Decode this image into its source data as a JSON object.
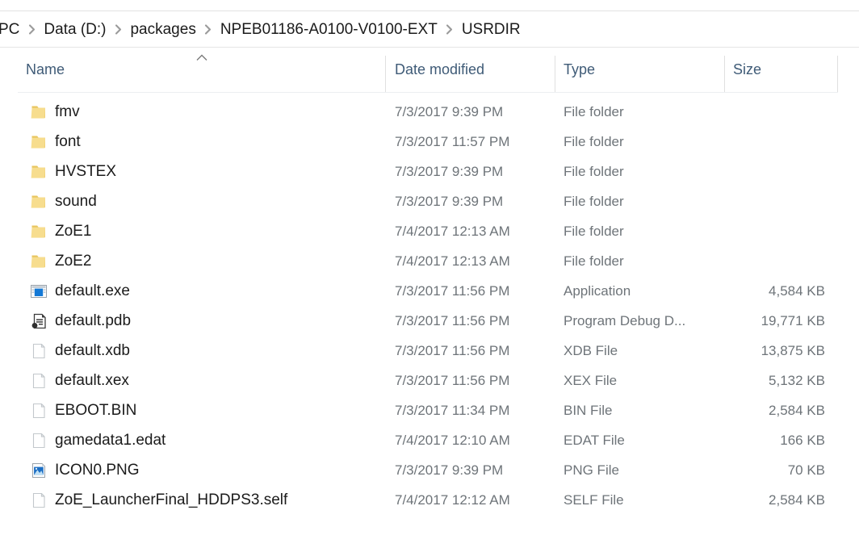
{
  "breadcrumb": {
    "name": "address-breadcrumb",
    "separator_icon": "chevron-right-icon",
    "items": [
      {
        "label": "PC"
      },
      {
        "label": "Data (D:)"
      },
      {
        "label": "packages"
      },
      {
        "label": "NPEB01186-A0100-V0100-EXT"
      },
      {
        "label": "USRDIR"
      }
    ]
  },
  "columns": {
    "name": "Name",
    "date_modified": "Date modified",
    "type": "Type",
    "size": "Size",
    "sort_icon": "sort-ascending-caret-icon",
    "sorted_by": "Name"
  },
  "files": [
    {
      "name": "fmv",
      "date_modified": "7/3/2017 9:39 PM",
      "type": "File folder",
      "size": "",
      "icon": "folder-icon"
    },
    {
      "name": "font",
      "date_modified": "7/3/2017 11:57 PM",
      "type": "File folder",
      "size": "",
      "icon": "folder-icon"
    },
    {
      "name": "HVSTEX",
      "date_modified": "7/3/2017 9:39 PM",
      "type": "File folder",
      "size": "",
      "icon": "folder-icon"
    },
    {
      "name": "sound",
      "date_modified": "7/3/2017 9:39 PM",
      "type": "File folder",
      "size": "",
      "icon": "folder-icon"
    },
    {
      "name": "ZoE1",
      "date_modified": "7/4/2017 12:13 AM",
      "type": "File folder",
      "size": "",
      "icon": "folder-icon"
    },
    {
      "name": "ZoE2",
      "date_modified": "7/4/2017 12:13 AM",
      "type": "File folder",
      "size": "",
      "icon": "folder-icon"
    },
    {
      "name": "default.exe",
      "date_modified": "7/3/2017 11:56 PM",
      "type": "Application",
      "size": "4,584 KB",
      "icon": "application-icon"
    },
    {
      "name": "default.pdb",
      "date_modified": "7/3/2017 11:56 PM",
      "type": "Program Debug D...",
      "size": "19,771 KB",
      "icon": "program-debug-database-icon"
    },
    {
      "name": "default.xdb",
      "date_modified": "7/3/2017 11:56 PM",
      "type": "XDB File",
      "size": "13,875 KB",
      "icon": "blank-document-icon"
    },
    {
      "name": "default.xex",
      "date_modified": "7/3/2017 11:56 PM",
      "type": "XEX File",
      "size": "5,132 KB",
      "icon": "blank-document-icon"
    },
    {
      "name": "EBOOT.BIN",
      "date_modified": "7/3/2017 11:34 PM",
      "type": "BIN File",
      "size": "2,584 KB",
      "icon": "blank-document-icon"
    },
    {
      "name": "gamedata1.edat",
      "date_modified": "7/4/2017 12:10 AM",
      "type": "EDAT File",
      "size": "166 KB",
      "icon": "blank-document-icon"
    },
    {
      "name": "ICON0.PNG",
      "date_modified": "7/3/2017 9:39 PM",
      "type": "PNG File",
      "size": "70 KB",
      "icon": "image-file-icon"
    },
    {
      "name": "ZoE_LauncherFinal_HDDPS3.self",
      "date_modified": "7/4/2017 12:12 AM",
      "type": "SELF File",
      "size": "2,584 KB",
      "icon": "blank-document-icon"
    }
  ],
  "colors": {
    "folder": "#f5d97a",
    "header_text": "#3f5b77",
    "body_text": "#1b1b1b",
    "secondary_text": "#6e7479",
    "divider": "#e0e0e0",
    "background": "#ffffff",
    "accent_blue": "#1e7fd4"
  }
}
